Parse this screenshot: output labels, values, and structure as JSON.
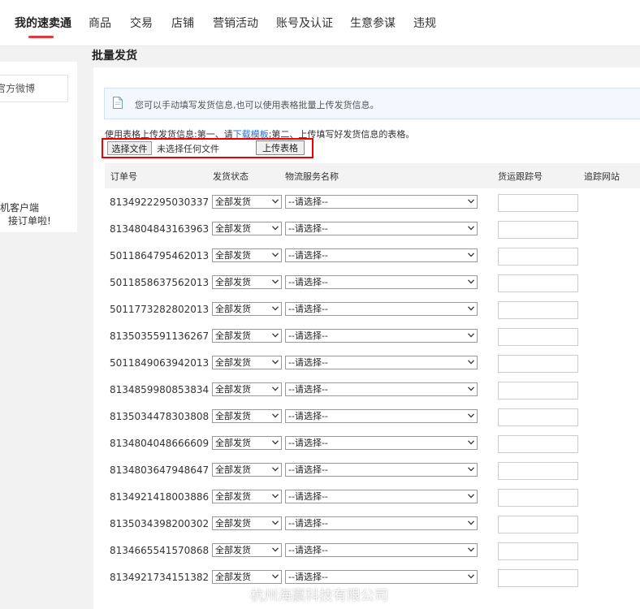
{
  "nav": {
    "items": [
      "我的速卖通",
      "商品",
      "交易",
      "店铺",
      "营销活动",
      "账号及认证",
      "生意参谋",
      "违规"
    ],
    "active_index": 0
  },
  "sidebar": {
    "weibo_text": "官方微博",
    "app_line1": "手机客户端",
    "app_line2": "接订单啦!"
  },
  "page": {
    "title": "批量发货",
    "notice": "您可以手动填写发货信息,也可以使用表格批量上传发货信息。",
    "instruction_prefix": "使用表格上传发货信息:第一、请",
    "instruction_link": "下载模板",
    "instruction_suffix": ";第二、上传填写好发货信息的表格。",
    "choose_file_label": "选择文件",
    "no_file_text": "未选择任何文件",
    "upload_button_label": "上传表格"
  },
  "table": {
    "headers": {
      "order_no": "订单号",
      "status": "发货状态",
      "logistics": "物流服务名称",
      "tracking": "货运跟踪号",
      "tracking_site": "追踪网站"
    },
    "status_default": "全部发货",
    "logistics_default": "--请选择--",
    "orders": [
      "8134922295030337",
      "8134804843163963",
      "5011864795462013",
      "5011858637562013",
      "5011773282802013",
      "8135035591136267",
      "5011849063942013",
      "8134859980853834",
      "8135034478303808",
      "8134804048666609",
      "8134803647948647",
      "8134921418003886",
      "8135034398200302",
      "8134665541570868",
      "8134921734151382"
    ]
  },
  "watermark": "杭州海赢科技有限公司",
  "colors": {
    "accent": "#e4393c",
    "link": "#2a6ecb",
    "highlight_box": "#ee0000"
  }
}
